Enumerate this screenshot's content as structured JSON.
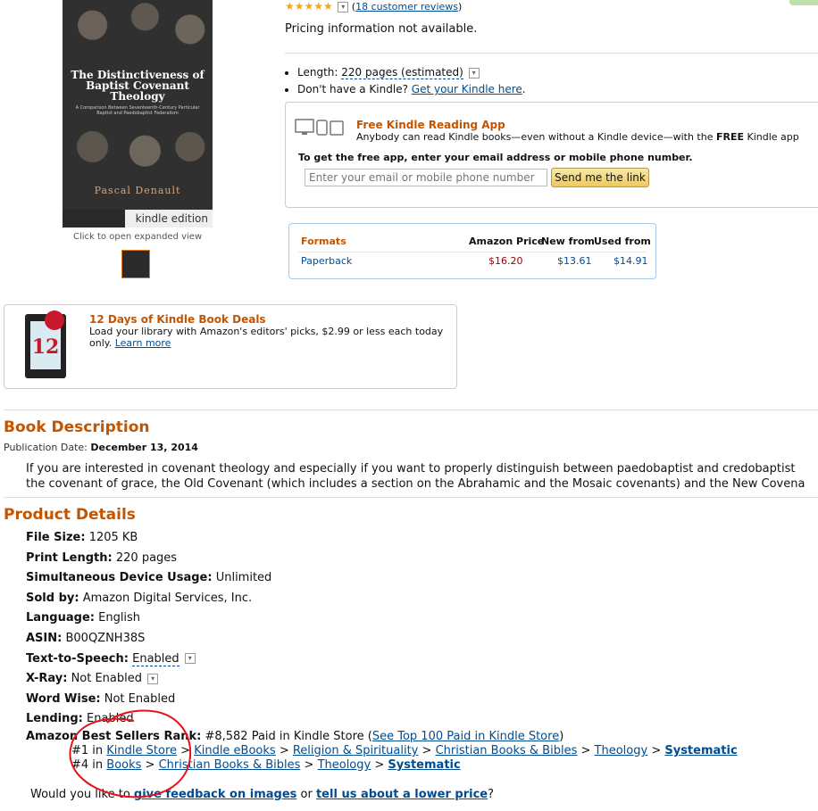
{
  "cover": {
    "title": "The Distinctiveness of Baptist Covenant Theology",
    "subtitle": "A Comparison Between Seventeenth-Century Particular Baptist and Paedobaptist Federalism",
    "author": "Pascal Denault",
    "badge": "kindle edition"
  },
  "image_caption": "Click to open expanded view",
  "rating": {
    "stars": 5,
    "reviews_link": "18 customer reviews"
  },
  "pricing": "Pricing information not available.",
  "bullets": {
    "length_label": "Length:",
    "length_value": "220 pages (estimated)",
    "kindle_question": "Don't have a Kindle?",
    "kindle_link": "Get your Kindle here",
    "kindle_period": "."
  },
  "app": {
    "title": "Free Kindle Reading App",
    "desc_1": "Anybody can read Kindle books—even without a Kindle device—with the ",
    "desc_bold": "FREE",
    "desc_2": " Kindle app",
    "get_label": "To get the free app, enter your email address or mobile phone number.",
    "input_placeholder": "Enter your email or mobile phone number",
    "send_button": "Send me the link"
  },
  "formats": {
    "headers": {
      "formats": "Formats",
      "amazon": "Amazon Price",
      "new": "New from",
      "used": "Used from"
    },
    "rows": [
      {
        "name": "Paperback",
        "amazon": "$16.20",
        "new": "$13.61",
        "used": "$14.91"
      }
    ]
  },
  "deals": {
    "badge_number": "12",
    "title": "12 Days of Kindle Book Deals",
    "desc": "Load your library with Amazon's editors' picks, $2.99 or less each today only.",
    "link": "Learn more"
  },
  "description": {
    "heading": "Book Description",
    "pub_label": "Publication Date:",
    "pub_date": "December 13, 2014",
    "line1": "If you are interested in covenant theology and especially if you want to properly distinguish between paedobaptist and credobaptist",
    "line2": "the covenant of grace, the Old Covenant (which includes a section on the Abrahamic and the Mosaic covenants) and the New Covena"
  },
  "details": {
    "heading": "Product Details",
    "rows": [
      {
        "label": "File Size:",
        "value": "1205 KB"
      },
      {
        "label": "Print Length:",
        "value": "220 pages"
      },
      {
        "label": "Simultaneous Device Usage:",
        "value": "Unlimited"
      },
      {
        "label": "Sold by:",
        "value": "Amazon Digital Services, Inc."
      },
      {
        "label": "Language:",
        "value": "English"
      },
      {
        "label": "ASIN:",
        "value": "B00QZNH38S"
      },
      {
        "label": "Text-to-Speech:",
        "value": "Enabled"
      },
      {
        "label": "X-Ray:",
        "value": "Not Enabled"
      },
      {
        "label": "Word Wise:",
        "value": "Not Enabled"
      },
      {
        "label": "Lending:",
        "value": "Enabled"
      }
    ]
  },
  "rank": {
    "label": "Amazon Best Sellers Rank:",
    "overall": "#8,582 Paid in Kindle Store (",
    "overall_link": "See Top 100 Paid in Kindle Store",
    "overall_close": ")",
    "line1_prefix": "#1 in ",
    "line1": [
      "Kindle Store",
      "Kindle eBooks",
      "Religion & Spirituality",
      "Christian Books & Bibles",
      "Theology",
      "Systematic"
    ],
    "line2_prefix": "#4 in ",
    "line2": [
      "Books",
      "Christian Books & Bibles",
      "Theology",
      "Systematic"
    ],
    "separator": " > "
  },
  "feedback": {
    "prefix": "Would you like to ",
    "link1": "give feedback on images",
    "middle": " or ",
    "link2": "tell us about a lower price",
    "suffix": "?"
  },
  "colors": {
    "accent_orange": "#c45500",
    "link_blue": "#004b91",
    "price_red": "#990000",
    "annotation_red": "#e8101a"
  }
}
